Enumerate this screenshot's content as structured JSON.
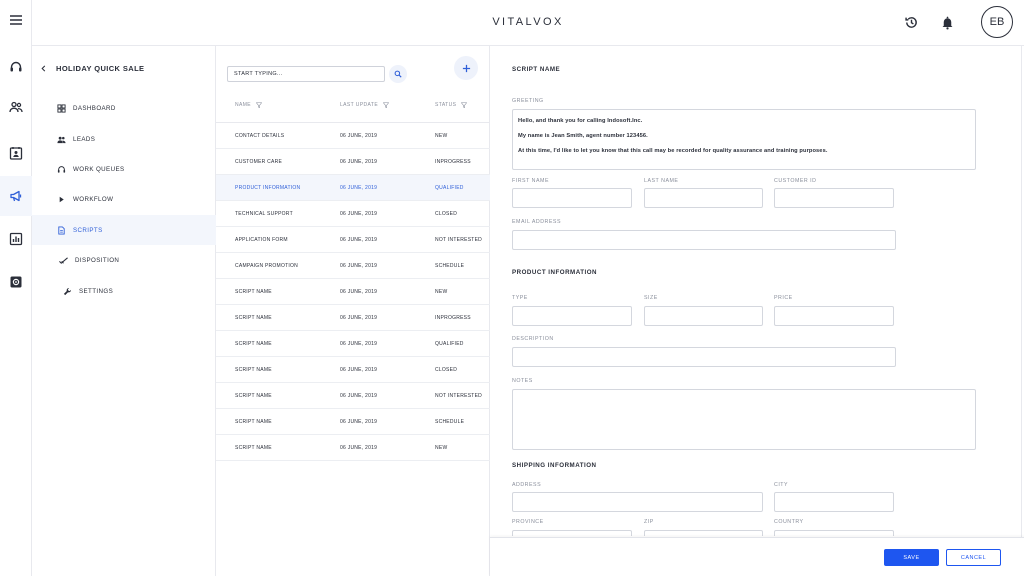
{
  "app": {
    "brand": "VITALVOX",
    "avatar_initials": "EB"
  },
  "colors": {
    "accent": "#2f5fd8",
    "primary_button": "#1e56f0",
    "active_bg": "#f3f6fc"
  },
  "rail": {
    "icons": [
      "menu-icon",
      "headset-icon",
      "people-icon",
      "contact-card-icon",
      "megaphone-icon",
      "bar-chart-icon",
      "settings-box-icon"
    ]
  },
  "header": {
    "icons": [
      "history-icon",
      "bell-icon"
    ]
  },
  "nav": {
    "title": "HOLIDAY QUICK SALE",
    "items": [
      {
        "label": "DASHBOARD",
        "icon": "dashboard-icon"
      },
      {
        "label": "LEADS",
        "icon": "leads-icon"
      },
      {
        "label": "WORK QUEUES",
        "icon": "headset-icon"
      },
      {
        "label": "WORKFLOW",
        "icon": "play-icon"
      },
      {
        "label": "SCRIPTS",
        "icon": "document-icon"
      },
      {
        "label": "DISPOSITION",
        "icon": "check-icon"
      },
      {
        "label": "SETTINGS",
        "icon": "wrench-icon"
      }
    ]
  },
  "list": {
    "search_placeholder": "START TYPING...",
    "columns": {
      "name": "NAME",
      "last_update": "LAST UPDATE",
      "status": "STATUS"
    },
    "rows": [
      {
        "name": "CONTACT DETAILS",
        "date": "06 JUNE, 2019",
        "status": "NEW"
      },
      {
        "name": "CUSTOMER CARE",
        "date": "06 JUNE, 2019",
        "status": "INPROGRESS"
      },
      {
        "name": "PRODUCT INFORMATION",
        "date": "06 JUNE, 2019",
        "status": "QUALIFIED"
      },
      {
        "name": "TECHNICAL SUPPORT",
        "date": "06 JUNE, 2019",
        "status": "CLOSED"
      },
      {
        "name": "APPLICATION FORM",
        "date": "06 JUNE, 2019",
        "status": "NOT INTERESTED"
      },
      {
        "name": "CAMPAIGN PROMOTION",
        "date": "06 JUNE, 2019",
        "status": "SCHEDULE"
      },
      {
        "name": "SCRIPT NAME",
        "date": "06 JUNE, 2019",
        "status": "NEW"
      },
      {
        "name": "SCRIPT NAME",
        "date": "06 JUNE, 2019",
        "status": "INPROGRESS"
      },
      {
        "name": "SCRIPT NAME",
        "date": "06 JUNE, 2019",
        "status": "QUALIFIED"
      },
      {
        "name": "SCRIPT NAME",
        "date": "06 JUNE, 2019",
        "status": "CLOSED"
      },
      {
        "name": "SCRIPT NAME",
        "date": "06 JUNE, 2019",
        "status": "NOT INTERESTED"
      },
      {
        "name": "SCRIPT NAME",
        "date": "06 JUNE, 2019",
        "status": "SCHEDULE"
      },
      {
        "name": "SCRIPT NAME",
        "date": "06 JUNE, 2019",
        "status": "NEW"
      }
    ]
  },
  "form": {
    "script_name_heading": "SCRIPT NAME",
    "greeting_label": "GREETING",
    "greeting_lines": [
      "Hello, and thank you for calling Indosoft.Inc.",
      "My name is Jean Smith, agent number 123456.",
      "At this time, I'd like to let you know that this call may be recorded for quality assurance and training purposes."
    ],
    "first_name_label": "FIRST NAME",
    "last_name_label": "LAST NAME",
    "customer_id_label": "CUSTOMER ID",
    "email_label": "EMAIL ADDRESS",
    "product_heading": "PRODUCT INFORMATION",
    "type_label": "TYPE",
    "size_label": "SIZE",
    "price_label": "PRICE",
    "description_label": "DESCRIPTION",
    "notes_label": "NOTES",
    "shipping_heading": "SHIPPING INFORMATION",
    "address_label": "ADDRESS",
    "city_label": "CITY",
    "province_label": "PROVINCE",
    "zip_label": "ZIP",
    "country_label": "COUNTRY"
  },
  "footer": {
    "save_label": "SAVE",
    "cancel_label": "CANCEL"
  }
}
